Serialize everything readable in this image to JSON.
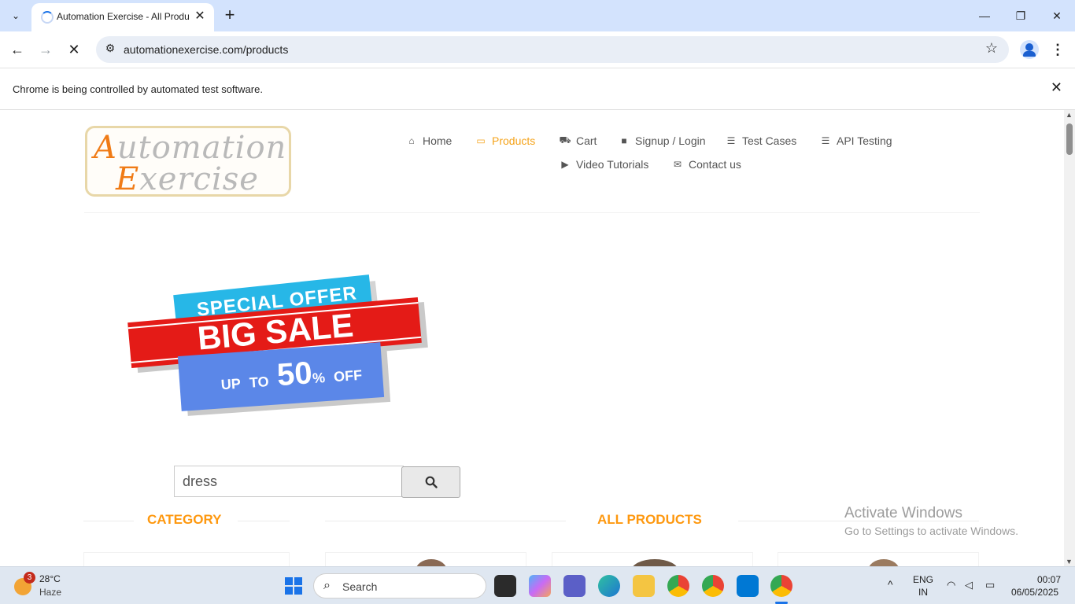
{
  "browser": {
    "tab_title": "Automation Exercise - All Produ",
    "tab_close": "✕",
    "new_tab": "+",
    "url": "automationexercise.com/products",
    "infobar_message": "Chrome is being controlled by automated test software.",
    "infobar_close": "✕",
    "back": "←",
    "forward": "→",
    "stop": "✕",
    "tune_icon": "⚙",
    "star": "☆",
    "kebab": "⋮",
    "tab_menu": "⌄",
    "minimize": "—",
    "restore": "❐",
    "close": "✕"
  },
  "site": {
    "logo_line1_cap": "A",
    "logo_line1_rest": "utomation",
    "logo_line2_cap": "E",
    "logo_line2_rest": "xercise",
    "nav": {
      "home": "Home",
      "products": "Products",
      "cart": "Cart",
      "signup": "Signup / Login",
      "test_cases": "Test Cases",
      "api_testing": "API Testing",
      "video": "Video Tutorials",
      "contact": "Contact us"
    },
    "banner": {
      "line1": "SPECIAL OFFER",
      "line2": "BIG SALE",
      "up": "UP",
      "to": "TO",
      "pct": "50",
      "pct_sign": "%",
      "off": "OFF"
    },
    "search_value": "dress",
    "category_title": "CATEGORY",
    "all_products_title": "ALL PRODUCTS"
  },
  "watermark": {
    "line1": "Activate Windows",
    "line2": "Go to Settings to activate Windows."
  },
  "taskbar": {
    "badge": "3",
    "temp": "28°C",
    "condition": "Haze",
    "search_label": "Search",
    "lang1": "ENG",
    "lang2": "IN",
    "time": "00:07",
    "date": "06/05/2025"
  },
  "colors": {
    "accent_orange": "#fe980f",
    "tabstrip": "#d3e3fd",
    "taskbar": "#dfe7f1"
  }
}
